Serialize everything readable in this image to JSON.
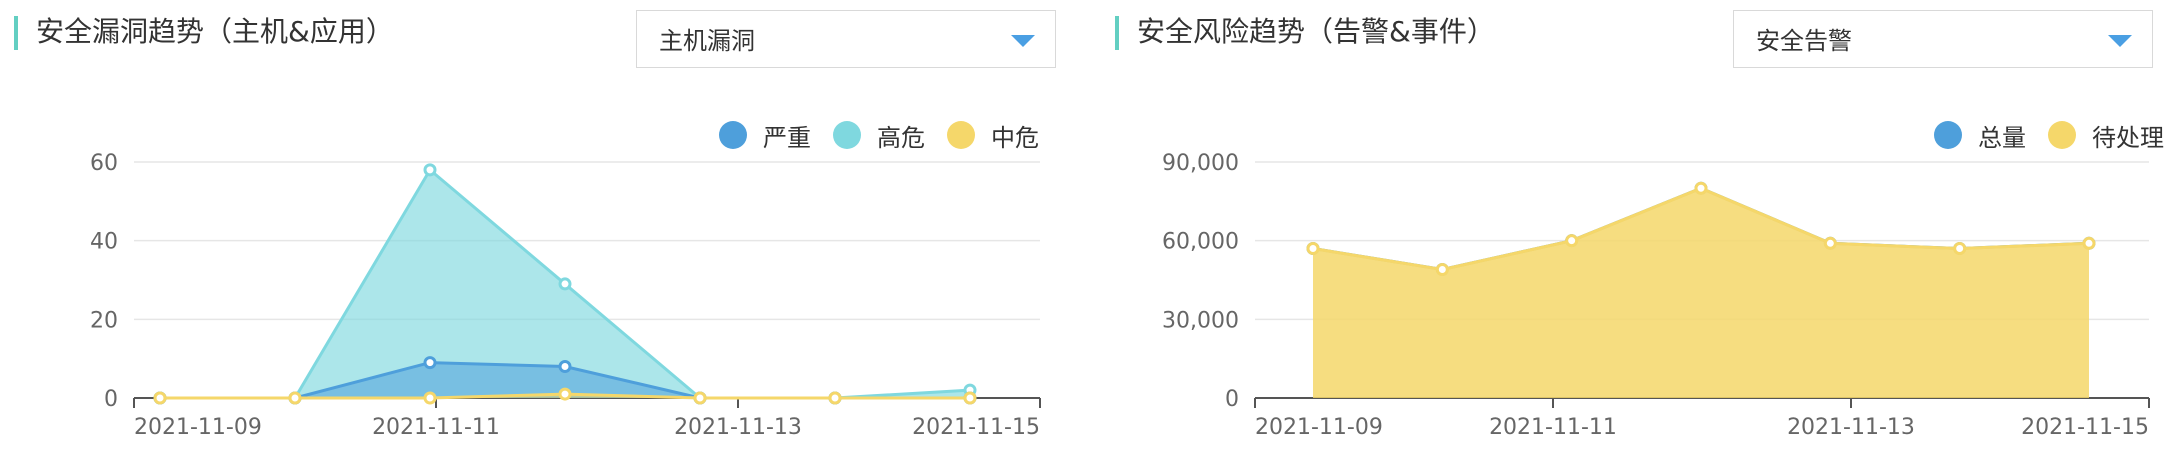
{
  "left_panel": {
    "title": "安全漏洞趋势（主机&应用）",
    "select": {
      "value": "主机漏洞",
      "icon": "chevron-down-icon"
    },
    "legend": [
      {
        "label": "严重",
        "color": "#4e9fdb"
      },
      {
        "label": "高危",
        "color": "#7fd8df"
      },
      {
        "label": "中危",
        "color": "#f5d76a"
      }
    ]
  },
  "right_panel": {
    "title": "安全风险趋势（告警&事件）",
    "select": {
      "value": "安全告警",
      "icon": "chevron-down-icon"
    },
    "legend": [
      {
        "label": "总量",
        "color": "#4e9fdb"
      },
      {
        "label": "待处理",
        "color": "#f5d76a"
      }
    ]
  },
  "chart_data": [
    {
      "type": "area",
      "title": "安全漏洞趋势（主机&应用）",
      "x": [
        "2021-11-09",
        "2021-11-10",
        "2021-11-11",
        "2021-11-12",
        "2021-11-13",
        "2021-11-14",
        "2021-11-15"
      ],
      "x_tick_labels": [
        "2021-11-09",
        "2021-11-11",
        "2021-11-13",
        "2021-11-15"
      ],
      "y_tick_labels": [
        "0",
        "20",
        "40",
        "60"
      ],
      "ylim": [
        0,
        60
      ],
      "grid": true,
      "legend_position": "top-right",
      "series": [
        {
          "name": "高危",
          "color": "#7fd8df",
          "values": [
            0,
            0,
            58,
            29,
            0,
            0,
            2
          ]
        },
        {
          "name": "严重",
          "color": "#4e9fdb",
          "values": [
            0,
            0,
            9,
            8,
            0,
            0,
            0
          ]
        },
        {
          "name": "中危",
          "color": "#f5d76a",
          "values": [
            0,
            0,
            0,
            1,
            0,
            0,
            0
          ]
        }
      ]
    },
    {
      "type": "area",
      "title": "安全风险趋势（告警&事件）",
      "x": [
        "2021-11-09",
        "2021-11-10",
        "2021-11-11",
        "2021-11-12",
        "2021-11-13",
        "2021-11-14",
        "2021-11-15"
      ],
      "x_tick_labels": [
        "2021-11-09",
        "2021-11-11",
        "2021-11-13",
        "2021-11-15"
      ],
      "y_tick_labels": [
        "0",
        "30,000",
        "60,000",
        "90,000"
      ],
      "ylim": [
        0,
        90000
      ],
      "grid": true,
      "legend_position": "top-right",
      "series": [
        {
          "name": "总量",
          "color": "#4e9fdb",
          "values": [
            57000,
            49000,
            60000,
            80000,
            59000,
            57000,
            59000
          ]
        },
        {
          "name": "待处理",
          "color": "#f5d76a",
          "values": [
            57000,
            49000,
            60000,
            80000,
            59000,
            57000,
            59000
          ]
        }
      ]
    }
  ]
}
